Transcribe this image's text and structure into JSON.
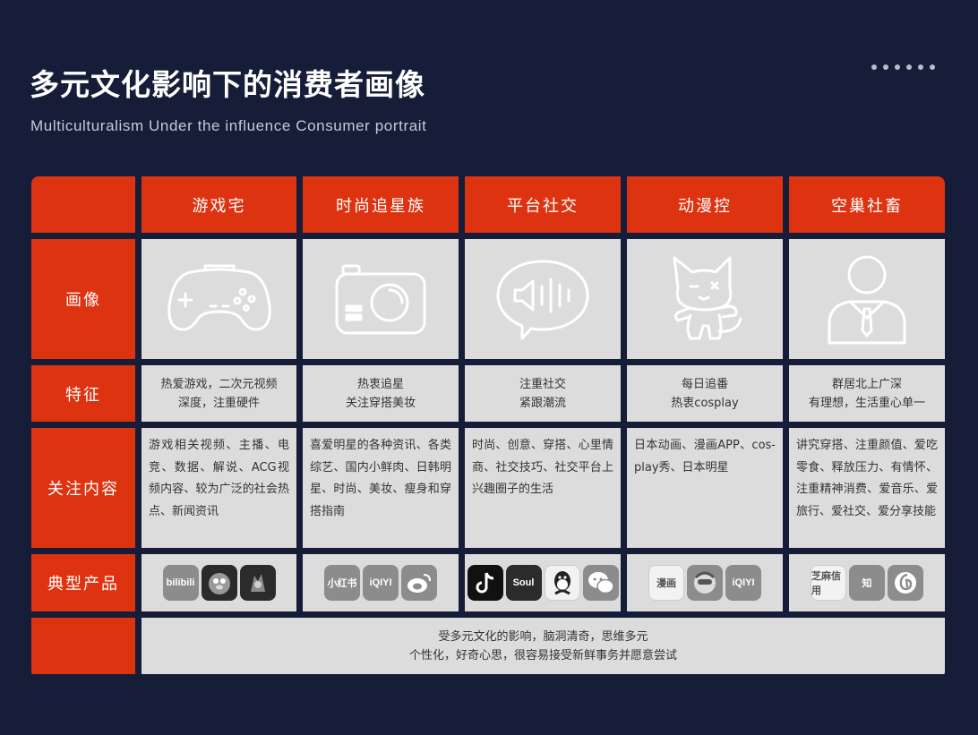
{
  "header": {
    "title": "多元文化影响下的消费者画像",
    "subtitle": "Multiculturalism Under the influence Consumer portrait"
  },
  "columns": [
    "游戏宅",
    "时尚追星族",
    "平台社交",
    "动漫控",
    "空巢社畜"
  ],
  "row_labels": {
    "portrait": "画像",
    "features": "特征",
    "interests": "关注内容",
    "products": "典型产品"
  },
  "portrait_icons": [
    "gamepad-icon",
    "camera-icon",
    "voice-chat-icon",
    "cat-doll-icon",
    "person-tie-icon"
  ],
  "features": [
    "热爱游戏，二次元视频\n深度，注重硬件",
    "热衷追星\n关注穿搭美妆",
    "注重社交\n紧跟潮流",
    "每日追番\n热衷cosplay",
    "群居北上广深\n有理想，生活重心单一"
  ],
  "interests": [
    "游戏相关视频、主播、电竞、数据、解说、ACG视频内容、较为广泛的社会热点、新闻资讯",
    "喜爱明星的各种资讯、各类综艺、国内小鲜肉、日韩明星、时尚、美妆、瘦身和穿搭指南",
    "时尚、创意、穿搭、心里情商、社交技巧、社交平台上兴趣圈子的生活",
    "日本动画、漫画APP、cos-play秀、日本明星",
    "讲究穿搭、注重颜值、爱吃零食、释放压力、有情怀、注重精神消费、爱音乐、爱旅行、爱社交、爱分享技能"
  ],
  "products": [
    [
      {
        "label": "bilibili",
        "icon": "bilibili-app-icon"
      },
      {
        "label": "",
        "icon": "penguin-game-app-icon"
      },
      {
        "label": "",
        "icon": "honor-of-kings-app-icon"
      }
    ],
    [
      {
        "label": "小红书",
        "icon": "xiaohongshu-app-icon"
      },
      {
        "label": "iQIYI",
        "icon": "iqiyi-app-icon"
      },
      {
        "label": "",
        "icon": "weibo-app-icon"
      }
    ],
    [
      {
        "label": "",
        "icon": "tiktok-app-icon"
      },
      {
        "label": "Soul",
        "icon": "soul-app-icon"
      },
      {
        "label": "",
        "icon": "qq-app-icon"
      },
      {
        "label": "",
        "icon": "wechat-app-icon"
      }
    ],
    [
      {
        "label": "漫画",
        "icon": "manga-app-icon"
      },
      {
        "label": "",
        "icon": "anime-character-app-icon"
      },
      {
        "label": "iQIYI",
        "icon": "iqiyi-app-icon"
      }
    ],
    [
      {
        "label": "芝麻信用",
        "icon": "sesame-credit-app-icon"
      },
      {
        "label": "知",
        "icon": "zhihu-app-icon"
      },
      {
        "label": "",
        "icon": "netease-music-app-icon"
      }
    ]
  ],
  "footer": "受多元文化的影响，脑洞清奇，思维多元\n个性化，好奇心思，很容易接受新鲜事务并愿意尝试",
  "colors": {
    "background": "#151d38",
    "accent": "#dd3311",
    "cell": "#dcdcdc"
  }
}
